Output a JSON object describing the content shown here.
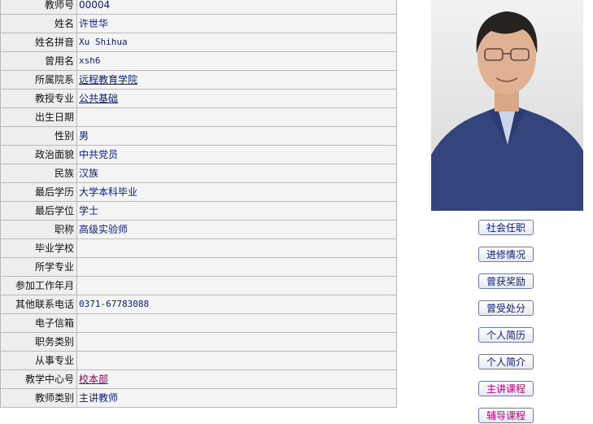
{
  "profile": {
    "rows": [
      {
        "label": "教师号",
        "value": "00004",
        "type": "text"
      },
      {
        "label": "姓名",
        "value": "许世华",
        "type": "text"
      },
      {
        "label": "姓名拼音",
        "value": "Xu Shihua",
        "type": "mono"
      },
      {
        "label": "曾用名",
        "value": "xsh6",
        "type": "mono"
      },
      {
        "label": "所属院系",
        "value": "远程教育学院",
        "type": "link"
      },
      {
        "label": "教授专业",
        "value": "公共基础",
        "type": "link"
      },
      {
        "label": "出生日期",
        "value": "",
        "type": "text"
      },
      {
        "label": "性别",
        "value": "男",
        "type": "text"
      },
      {
        "label": "政治面貌",
        "value": "中共党员",
        "type": "text"
      },
      {
        "label": "民族",
        "value": "汉族",
        "type": "text"
      },
      {
        "label": "最后学历",
        "value": "大学本科毕业",
        "type": "text"
      },
      {
        "label": "最后学位",
        "value": "学士",
        "type": "text"
      },
      {
        "label": "职称",
        "value": "高级实验师",
        "type": "text"
      },
      {
        "label": "毕业学校",
        "value": "",
        "type": "text"
      },
      {
        "label": "所学专业",
        "value": "",
        "type": "text"
      },
      {
        "label": "参加工作年月",
        "value": "",
        "type": "text"
      },
      {
        "label": "其他联系电话",
        "value": "0371-67783088",
        "type": "mono"
      },
      {
        "label": "电子信箱",
        "value": "",
        "type": "text"
      },
      {
        "label": "职务类别",
        "value": "",
        "type": "text"
      },
      {
        "label": "从事专业",
        "value": "",
        "type": "text"
      },
      {
        "label": "教学中心号",
        "value": "校本部",
        "type": "link-pink"
      },
      {
        "label": "教师类别",
        "value": "主讲教师",
        "type": "text"
      }
    ]
  },
  "side_buttons": [
    {
      "label": "社会任职",
      "color": "blue"
    },
    {
      "label": "进修情况",
      "color": "blue"
    },
    {
      "label": "曾获奖励",
      "color": "blue"
    },
    {
      "label": "曾受处分",
      "color": "blue"
    },
    {
      "label": "个人简历",
      "color": "blue"
    },
    {
      "label": "个人简介",
      "color": "blue"
    },
    {
      "label": "主讲课程",
      "color": "magenta"
    },
    {
      "label": "辅导课程",
      "color": "magenta"
    }
  ],
  "colors": {
    "label_bg": "#eeeeee",
    "value_bg": "#f4f4f4",
    "border": "#b9b9b9",
    "value_text": "#0a1b7a",
    "magenta": "#c0007a"
  }
}
